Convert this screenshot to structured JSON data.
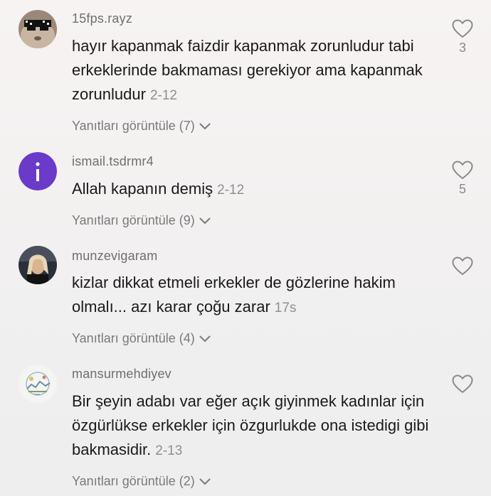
{
  "comments": [
    {
      "username": "15fps.rayz",
      "text": "hayır kapanmak faizdir kapanmak zorunludur tabi erkeklerinde bakmaması gerekiyor ama kapanmak zorunludur",
      "time": "2-12",
      "replies_label": "Yanıtları görüntüle (7)",
      "likes": "3",
      "avatar_icon": "sunglasses-cat-avatar"
    },
    {
      "username": "ismail.tsdrmr4",
      "text": "Allah kapanın demiş",
      "time": "2-12",
      "replies_label": "Yanıtları görüntüle (9)",
      "likes": "5",
      "avatar_letter": "i",
      "avatar_color": "#6a3ac9"
    },
    {
      "username": "munzevigaram",
      "text": "kizlar dikkat etmeli erkekler de gözlerine hakim olmalı... azı karar çoğu zarar",
      "time": "17s",
      "replies_label": "Yanıtları görüntüle (4)",
      "likes": "",
      "avatar_icon": "photo-avatar"
    },
    {
      "username": "mansurmehdiyev",
      "text": "Bir şeyin adabı var eğer açık giyinmek kadınlar için özgürlükse erkekler için özgurlukde ona istedigi gibi bakmasidir.",
      "time": "2-13",
      "replies_label": "Yanıtları görüntüle (2)",
      "likes": "",
      "avatar_icon": "illustration-avatar"
    }
  ]
}
